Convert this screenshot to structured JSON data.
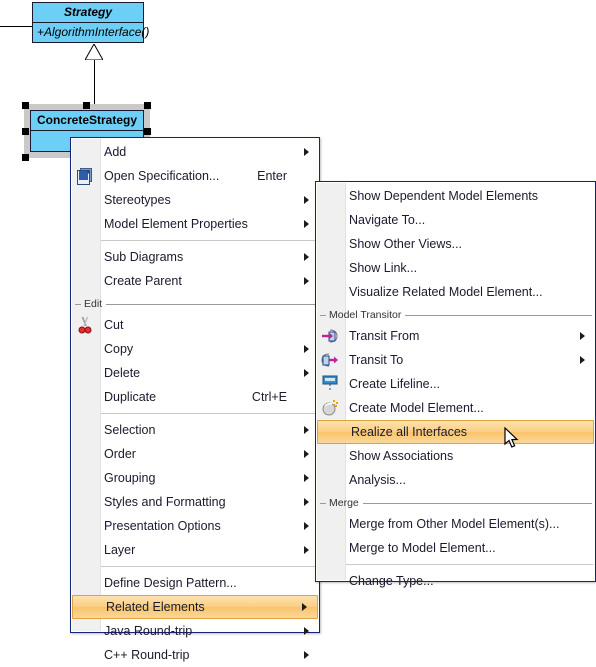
{
  "diagram": {
    "classes": [
      {
        "name": "Strategy",
        "stereotype_italic": true,
        "operations": [
          "+AlgorithmInterface()"
        ],
        "fill_color": "#6DCFF6",
        "border_color": "#1a1a2e"
      },
      {
        "name": "ConcreteStrategy",
        "stereotype_italic": false,
        "operations": [
          ""
        ],
        "fill_color": "#6DCFF6",
        "border_color": "#1a1a2e",
        "selected": true
      }
    ],
    "relationship": "generalization"
  },
  "context_menu": {
    "name": "element-context-menu",
    "groups": [
      {
        "label": null,
        "items": [
          {
            "label": "Add",
            "submenu": true,
            "accel": "",
            "icon": null
          },
          {
            "label": "Open Specification...",
            "submenu": false,
            "accel": "Enter",
            "icon": "open-specification-icon"
          },
          {
            "label": "Stereotypes",
            "submenu": true,
            "accel": "",
            "icon": null
          },
          {
            "label": "Model Element Properties",
            "submenu": true,
            "accel": "",
            "icon": null
          }
        ]
      },
      {
        "label": null,
        "items": [
          {
            "label": "Sub Diagrams",
            "submenu": true,
            "accel": "",
            "icon": null
          },
          {
            "label": "Create Parent",
            "submenu": true,
            "accel": "",
            "icon": null
          }
        ]
      },
      {
        "label": "Edit",
        "items": [
          {
            "label": "Cut",
            "submenu": false,
            "accel": "",
            "icon": "scissors-icon"
          },
          {
            "label": "Copy",
            "submenu": true,
            "accel": "",
            "icon": null
          },
          {
            "label": "Delete",
            "submenu": true,
            "accel": "",
            "icon": null
          },
          {
            "label": "Duplicate",
            "submenu": false,
            "accel": "Ctrl+E",
            "icon": null
          }
        ]
      },
      {
        "label": null,
        "items": [
          {
            "label": "Selection",
            "submenu": true,
            "accel": "",
            "icon": null
          },
          {
            "label": "Order",
            "submenu": true,
            "accel": "",
            "icon": null
          },
          {
            "label": "Grouping",
            "submenu": true,
            "accel": "",
            "icon": null
          },
          {
            "label": "Styles and Formatting",
            "submenu": true,
            "accel": "",
            "icon": null
          },
          {
            "label": "Presentation Options",
            "submenu": true,
            "accel": "",
            "icon": null
          },
          {
            "label": "Layer",
            "submenu": true,
            "accel": "",
            "icon": null
          }
        ]
      },
      {
        "label": null,
        "items": [
          {
            "label": "Define Design Pattern...",
            "submenu": false,
            "accel": "",
            "icon": null
          },
          {
            "label": "Related Elements",
            "submenu": true,
            "accel": "",
            "icon": null,
            "highlighted": true
          },
          {
            "label": "Java Round-trip",
            "submenu": true,
            "accel": "",
            "icon": null
          },
          {
            "label": "C++ Round-trip",
            "submenu": true,
            "accel": "",
            "icon": null
          }
        ]
      }
    ]
  },
  "submenu": {
    "name": "related-elements-submenu",
    "groups": [
      {
        "label": null,
        "items": [
          {
            "label": "Show Dependent Model Elements",
            "submenu": false,
            "accel": "",
            "icon": null
          },
          {
            "label": "Navigate To...",
            "submenu": false,
            "accel": "",
            "icon": null
          },
          {
            "label": "Show Other Views...",
            "submenu": false,
            "accel": "",
            "icon": null
          },
          {
            "label": "Show Link...",
            "submenu": false,
            "accel": "",
            "icon": null
          },
          {
            "label": "Visualize Related Model Element...",
            "submenu": false,
            "accel": "",
            "icon": null
          }
        ]
      },
      {
        "label": "Model Transitor",
        "items": [
          {
            "label": "Transit From",
            "submenu": true,
            "accel": "",
            "icon": "transit-from-icon"
          },
          {
            "label": "Transit To",
            "submenu": true,
            "accel": "",
            "icon": "transit-to-icon"
          },
          {
            "label": "Create Lifeline...",
            "submenu": false,
            "accel": "",
            "icon": "create-lifeline-icon"
          },
          {
            "label": "Create Model Element...",
            "submenu": false,
            "accel": "",
            "icon": "create-model-element-icon"
          },
          {
            "label": "Realize all Interfaces",
            "submenu": false,
            "accel": "",
            "icon": null,
            "highlighted": true
          },
          {
            "label": "Show Associations",
            "submenu": false,
            "accel": "",
            "icon": null
          },
          {
            "label": "Analysis...",
            "submenu": false,
            "accel": "",
            "icon": null
          }
        ]
      },
      {
        "label": "Merge",
        "items": [
          {
            "label": "Merge from Other Model Element(s)...",
            "submenu": false,
            "accel": "",
            "icon": null
          },
          {
            "label": "Merge to Model Element...",
            "submenu": false,
            "accel": "",
            "icon": null
          }
        ]
      },
      {
        "label": null,
        "items": [
          {
            "label": "Change Type...",
            "submenu": false,
            "accel": "",
            "icon": null
          }
        ]
      }
    ]
  },
  "colors": {
    "class_fill": "#6DCFF6",
    "highlight_start": "#fde2b0",
    "highlight_end": "#fbd79c",
    "highlight_border": "#e0a23d",
    "menu_border": "#16237a",
    "gutter": "#f0f0f0"
  }
}
